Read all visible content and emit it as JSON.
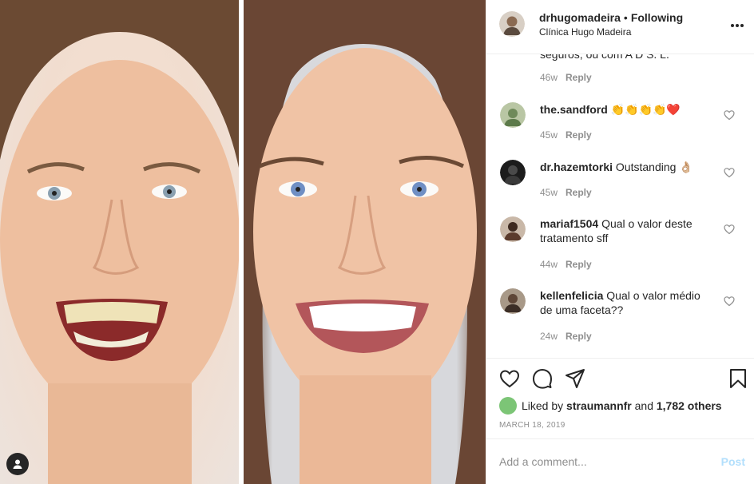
{
  "post": {
    "username": "drhugomadeira",
    "separator": "•",
    "follow_status": "Following",
    "location": "Clínica Hugo Madeira"
  },
  "comments": {
    "partial_text": "seguros, ou com A D S. L.",
    "partial_age": "46w",
    "reply_label": "Reply",
    "items": [
      {
        "username": "the.sandford",
        "text": "👏👏👏👏❤️",
        "age": "45w"
      },
      {
        "username": "dr.hazemtorki",
        "text": "Outstanding 👌🏼",
        "age": "45w"
      },
      {
        "username": "mariaf1504",
        "text": "Qual o valor deste tratamento sff",
        "age": "44w"
      },
      {
        "username": "kellenfelicia",
        "text": "Qual o valor médio de uma faceta??",
        "age": "24w"
      }
    ]
  },
  "likes": {
    "prefix": "Liked by",
    "user": "straumannfr",
    "and": "and",
    "others": "1,782 others"
  },
  "date": "MARCH 18, 2019",
  "add_comment": {
    "placeholder": "Add a comment...",
    "post_label": "Post"
  },
  "icons": {
    "more": "more-options-icon",
    "like": "heart-icon",
    "comment": "comment-icon",
    "share": "share-icon",
    "save": "bookmark-icon",
    "tag": "user-tag-icon"
  }
}
